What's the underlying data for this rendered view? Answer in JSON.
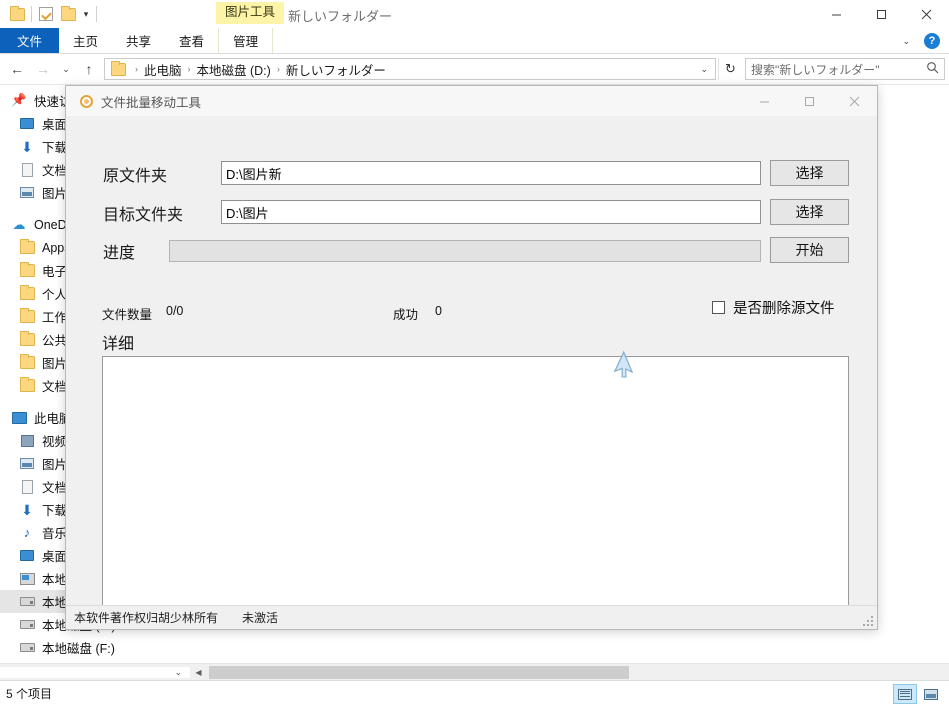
{
  "explorer": {
    "window_title": "新しいフォルダー",
    "context_tab_group": "图片工具",
    "quick_access": [
      {
        "name": "folder-icon",
        "label": ""
      },
      {
        "name": "properties-icon",
        "label": ""
      },
      {
        "name": "new-folder-icon",
        "label": ""
      },
      {
        "name": "customize-chevron-icon",
        "label": "▾"
      }
    ],
    "ribbon_tabs": [
      {
        "id": "file",
        "label": "文件"
      },
      {
        "id": "home",
        "label": "主页"
      },
      {
        "id": "share",
        "label": "共享"
      },
      {
        "id": "view",
        "label": "查看"
      },
      {
        "id": "manage",
        "label": "管理"
      }
    ],
    "ribbon_collapse_chevron": "⌄",
    "help_label": "?",
    "window_controls": {
      "minimize": "—",
      "maximize": "☐",
      "close": "✕"
    },
    "address": {
      "back": "←",
      "forward": "→",
      "recent_chevron": "⌄",
      "up": "↑",
      "crumbs": [
        "此电脑",
        "本地磁盘 (D:)",
        "新しいフォルダー"
      ],
      "crumb_separator": "›",
      "dropdown_chevron": "⌄",
      "refresh": "↻"
    },
    "search": {
      "placeholder": "搜索\"新しいフォルダー\"",
      "icon": "search-icon"
    },
    "nav_sections": [
      {
        "id": "quick-access",
        "root": {
          "label": "快速访问",
          "icon": "pin-icon"
        },
        "items": [
          {
            "label": "桌面",
            "icon": "desktop-icon"
          },
          {
            "label": "下载",
            "icon": "download-icon"
          },
          {
            "label": "文档",
            "icon": "documents-icon"
          },
          {
            "label": "图片",
            "icon": "pictures-icon"
          }
        ]
      },
      {
        "id": "onedrive",
        "root": {
          "label": "OneDrive",
          "icon": "cloud-icon"
        },
        "items": [
          {
            "label": "Apps",
            "icon": "folder-icon"
          },
          {
            "label": "电子邮件附件",
            "icon": "folder-icon"
          },
          {
            "label": "个人保管库",
            "icon": "folder-icon"
          },
          {
            "label": "工作簿",
            "icon": "folder-icon"
          },
          {
            "label": "公共",
            "icon": "folder-icon"
          },
          {
            "label": "图片",
            "icon": "folder-icon"
          },
          {
            "label": "文档",
            "icon": "folder-icon"
          }
        ]
      },
      {
        "id": "this-pc",
        "root": {
          "label": "此电脑",
          "icon": "pc-icon"
        },
        "items": [
          {
            "label": "视频",
            "icon": "video-icon"
          },
          {
            "label": "图片",
            "icon": "pictures-icon"
          },
          {
            "label": "文档",
            "icon": "documents-icon"
          },
          {
            "label": "下载",
            "icon": "download-icon"
          },
          {
            "label": "音乐",
            "icon": "music-icon"
          },
          {
            "label": "桌面",
            "icon": "desktop-icon"
          },
          {
            "label": "本地磁盘 (C:)",
            "icon": "system-disk-icon"
          },
          {
            "label": "本地磁盘 (D:)",
            "icon": "disk-icon",
            "selected": true
          },
          {
            "label": "本地磁盘 (E:)",
            "icon": "disk-icon"
          },
          {
            "label": "本地磁盘 (F:)",
            "icon": "disk-icon"
          }
        ]
      }
    ],
    "status": {
      "item_count": "5 个项目"
    },
    "view_buttons": [
      {
        "id": "details-view",
        "label": "",
        "active": true
      },
      {
        "id": "large-icons-view",
        "label": "",
        "active": false
      }
    ]
  },
  "dialog": {
    "title": "文件批量移动工具",
    "icon": "app-gear-icon",
    "window_controls": {
      "minimize": "—",
      "maximize": "☐",
      "close": "✕"
    },
    "fields": {
      "source": {
        "label": "原文件夹",
        "value": "D:\\图片新",
        "button": "选择"
      },
      "target": {
        "label": "目标文件夹",
        "value": "D:\\图片",
        "button": "选择"
      },
      "progress": {
        "label": "进度",
        "percent": 0,
        "button": "开始"
      }
    },
    "stats": {
      "file_count_label": "文件数量",
      "file_count_value": "0/0",
      "success_label": "成功",
      "success_value": "0"
    },
    "delete_source": {
      "label": "是否删除源文件",
      "checked": false
    },
    "detail": {
      "label": "详细",
      "content": ""
    },
    "statusbar": {
      "copyright": "本软件著作权归胡少林所有",
      "activation": "未激活"
    }
  },
  "colors": {
    "accent": "#0c61ba",
    "context_tab": "#fdf4a8",
    "selection": "#e5e5e5",
    "dialog_bg": "#f0f0f0"
  }
}
